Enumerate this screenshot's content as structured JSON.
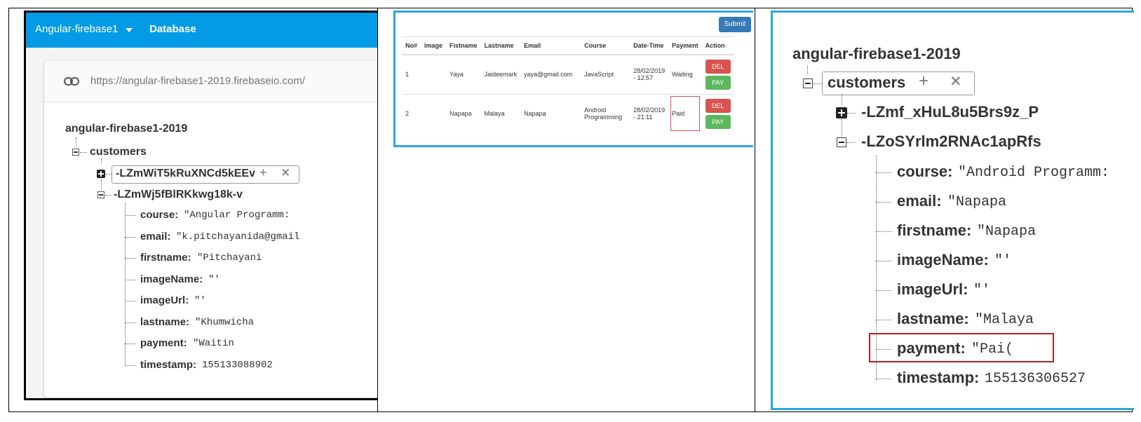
{
  "panel1": {
    "project_name": "Angular-firebase1",
    "db_tab": "Database",
    "url": "https://angular-firebase1-2019.firebaseio.com/",
    "root": "angular-firebase1-2019",
    "customers": "customers",
    "record_a": "-LZmWiT5kRuXNCd5kEEv",
    "record_b": "-LZmWj5fBlRKkwg18k-v",
    "fields": [
      {
        "key": "course:",
        "value": "\"Angular Programm:"
      },
      {
        "key": "email:",
        "value": "\"k.pitchayanida@gmail"
      },
      {
        "key": "firstname:",
        "value": "\"Pitchayani"
      },
      {
        "key": "imageName:",
        "value": "\"'"
      },
      {
        "key": "imageUrl:",
        "value": "\"'"
      },
      {
        "key": "lastname:",
        "value": "\"Khumwicha"
      },
      {
        "key": "payment:",
        "value": "\"Waitin"
      },
      {
        "key": "timestamp:",
        "value": "155133088902"
      }
    ]
  },
  "panel2": {
    "submit": "Submit",
    "headers": [
      "No#",
      "Image",
      "Fistname",
      "Lastname",
      "Email",
      "Course",
      "Date-Time",
      "Payment",
      "Action"
    ],
    "rows": [
      {
        "no": "1",
        "image": "",
        "first": "Yaya",
        "last": "Jaideemark",
        "email": "yaya@gmail.com",
        "course": "JavaScript",
        "date1": "28/02/2019",
        "date2": "- 12:57",
        "payment": "Waiting",
        "del": "DEL",
        "pay": "PAY"
      },
      {
        "no": "2",
        "image": "",
        "first": "Napapa",
        "last": "Malaya",
        "email": "Napapa",
        "course1": "Android",
        "course2": "Programming",
        "date1": "28/02/2019",
        "date2": "- 21:11",
        "payment": "Paid",
        "del": "DEL",
        "pay": "PAY"
      }
    ],
    "highlight_color": "#d9534f"
  },
  "panel3": {
    "root": "angular-firebase1-2019",
    "customers": "customers",
    "record_a": "-LZmf_xHuL8u5Brs9z_P",
    "record_b": "-LZoSYrlm2RNAc1apRfs",
    "fields": [
      {
        "key": "course:",
        "value": "\"Android Programm:"
      },
      {
        "key": "email:",
        "value": "\"Napapa"
      },
      {
        "key": "firstname:",
        "value": "\"Napapa"
      },
      {
        "key": "imageName:",
        "value": "\"'"
      },
      {
        "key": "imageUrl:",
        "value": "\"'"
      },
      {
        "key": "lastname:",
        "value": "\"Malaya"
      },
      {
        "key": "payment:",
        "value": "\"Pai("
      },
      {
        "key": "timestamp:",
        "value": "155136306527"
      }
    ]
  },
  "colors": {
    "firebase_bar": "#039be5",
    "frame_blue": "#29a8e0",
    "highlight_red": "#b22222"
  },
  "icons": {
    "plus": "plus-icon",
    "close": "close-icon",
    "link": "link-icon",
    "caret": "caret-down-icon"
  }
}
